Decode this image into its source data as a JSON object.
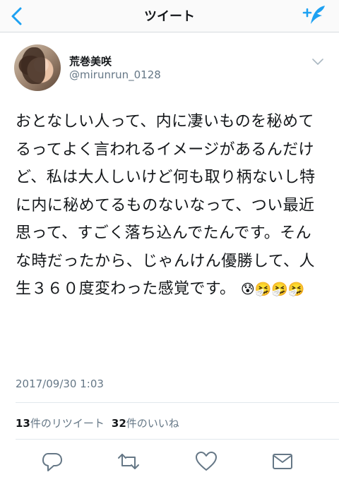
{
  "nav": {
    "title": "ツイート",
    "back_icon": "chevron-left-icon",
    "compose_icon": "compose-tweet-icon"
  },
  "user": {
    "display_name": "荒巻美咲",
    "username": "@mirunrun_0128"
  },
  "tweet": {
    "text": "おとなしい人って、内に凄いものを秘めてるってよく言われるイメージがあるんだけど、私は大人しいけど何も取り柄ないし特に内に秘めてるものないなって、つい最近思って、すごく落ち込んでたんです。そんな時だったから、じゃんけん優勝して、人生３６０度変わった感覚です。",
    "emoji": "😰🤧🤧🤧",
    "timestamp": "2017/09/30 1:03"
  },
  "stats": {
    "retweet_count": "13",
    "retweet_label": "件のリツイート",
    "like_count": "32",
    "like_label": "件のいいね"
  },
  "actions": [
    "reply-icon",
    "retweet-icon",
    "like-icon",
    "direct-message-icon"
  ],
  "colors": {
    "accent": "#1da1f2",
    "text": "#14171a",
    "secondary": "#657786",
    "divider": "#e1e8ed"
  }
}
